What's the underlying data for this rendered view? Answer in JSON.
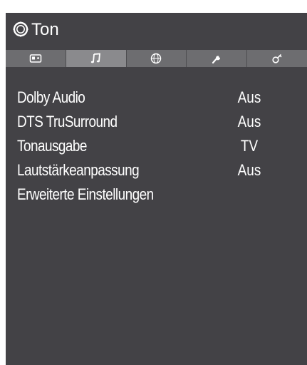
{
  "header": {
    "title": "Ton",
    "icon": "gear-icon"
  },
  "tabs": [
    {
      "name": "picture",
      "icon": "picture-icon",
      "active": false
    },
    {
      "name": "sound",
      "icon": "music-note-icon",
      "active": true
    },
    {
      "name": "network",
      "icon": "globe-icon",
      "active": false
    },
    {
      "name": "setup",
      "icon": "wrench-icon",
      "active": false
    },
    {
      "name": "other",
      "icon": "key-icon",
      "active": false
    }
  ],
  "menu": {
    "items": [
      {
        "label": "Dolby Audio",
        "value": "Aus"
      },
      {
        "label": "DTS TruSurround",
        "value": "Aus"
      },
      {
        "label": "Tonausgabe",
        "value": "TV"
      },
      {
        "label": "Lautstärkeanpassung",
        "value": "Aus"
      },
      {
        "label": "Erweiterte Einstellungen",
        "value": ""
      }
    ]
  },
  "colors": {
    "panel": "#434246",
    "tab_bar": "#6d6d70",
    "tab_active": "#8a8a8d",
    "text": "#ffffff"
  }
}
